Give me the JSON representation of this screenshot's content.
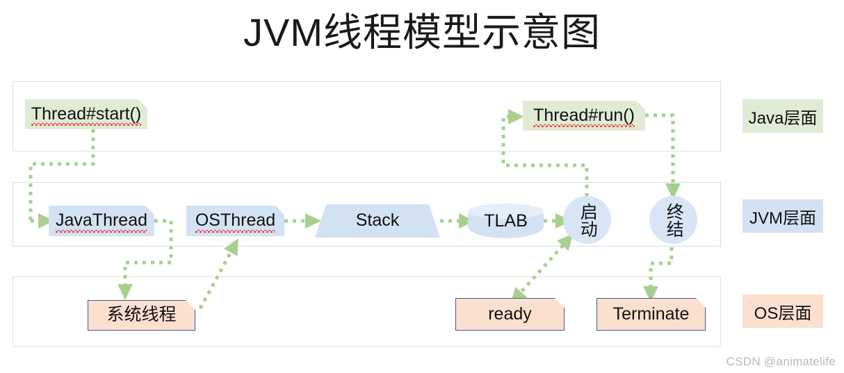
{
  "title": "JVM线程模型示意图",
  "watermark": "CSDN @animatelife",
  "legend": {
    "java": "Java层面",
    "jvm": "JVM层面",
    "os": "OS层面"
  },
  "layers": {
    "java": {
      "name": "Java层面",
      "border_color": "#d8e6cd",
      "fill_color": "#dfebd4",
      "nodes": [
        {
          "id": "thread-start",
          "label": "Thread#start()",
          "shape": "note",
          "misspelled": true
        },
        {
          "id": "thread-run",
          "label": "Thread#run()",
          "shape": "note",
          "misspelled": true
        }
      ]
    },
    "jvm": {
      "name": "JVM层面",
      "border_color": "#cddff0",
      "fill_color": "#d3e2f3",
      "nodes": [
        {
          "id": "java-thread",
          "label": "JavaThread",
          "shape": "note",
          "misspelled": true
        },
        {
          "id": "os-thread",
          "label": "OSThread",
          "shape": "note",
          "misspelled": true
        },
        {
          "id": "stack",
          "label": "Stack",
          "shape": "trapezoid",
          "misspelled": false
        },
        {
          "id": "tlab",
          "label": "TLAB",
          "shape": "cylinder",
          "misspelled": false
        },
        {
          "id": "qidong",
          "label": "启动",
          "shape": "circle",
          "misspelled": false
        },
        {
          "id": "zhongjie",
          "label": "终结",
          "shape": "circle",
          "misspelled": false
        }
      ]
    },
    "os": {
      "name": "OS层面",
      "border_color": "#f7ddcd",
      "fill_color": "#fbe0d0",
      "nodes": [
        {
          "id": "system-thread",
          "label": "系统线程",
          "shape": "note-outlined",
          "misspelled": false
        },
        {
          "id": "ready",
          "label": "ready",
          "shape": "note-outlined",
          "misspelled": false
        },
        {
          "id": "terminate",
          "label": "Terminate",
          "shape": "note-outlined",
          "misspelled": false
        }
      ]
    }
  },
  "connections": [
    {
      "from": "thread-start",
      "to": "java-thread",
      "style": "dotted",
      "direction": "one-way"
    },
    {
      "from": "java-thread",
      "to": "system-thread",
      "style": "dotted",
      "direction": "one-way"
    },
    {
      "from": "system-thread",
      "to": "os-thread",
      "style": "dotted",
      "direction": "one-way"
    },
    {
      "from": "os-thread",
      "to": "stack",
      "style": "dotted",
      "direction": "one-way"
    },
    {
      "from": "stack",
      "to": "tlab",
      "style": "dotted",
      "direction": "one-way"
    },
    {
      "from": "tlab",
      "to": "qidong",
      "style": "dotted",
      "direction": "one-way"
    },
    {
      "from": "qidong",
      "to": "ready",
      "style": "dotted",
      "direction": "two-way"
    },
    {
      "from": "qidong",
      "to": "thread-run",
      "style": "dotted",
      "direction": "one-way"
    },
    {
      "from": "thread-run",
      "to": "zhongjie",
      "style": "dotted",
      "direction": "one-way"
    },
    {
      "from": "zhongjie",
      "to": "terminate",
      "style": "dotted",
      "direction": "one-way"
    }
  ],
  "colors": {
    "arrow": "#a9cf8f",
    "green_fill": "#dfebd4",
    "blue_fill": "#d3e2f3",
    "peach_fill": "#fbe0d0",
    "os_border": "#3f5b8c",
    "text": "#111111",
    "watermark": "#b9b9b9"
  }
}
